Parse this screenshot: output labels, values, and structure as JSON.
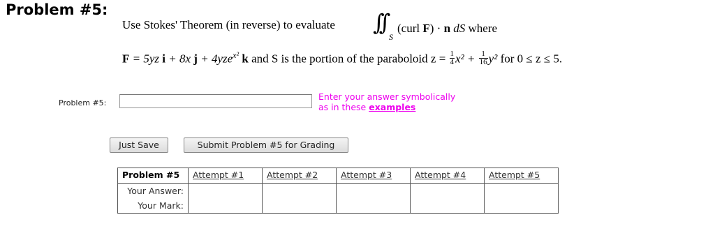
{
  "title": "Problem #5:",
  "statement": {
    "line1_pre": "Use Stokes' Theorem (in reverse) to evaluate",
    "integral_sign": "∫∫",
    "integral_sub": "S",
    "line1_post_a": "(curl ",
    "line1_post_F": "F",
    "line1_post_b": ") · ",
    "line1_post_n": "n",
    "line1_post_c": " dS",
    "line1_post_d": " where",
    "F_label": "F",
    "F_eq": " = 5yz ",
    "i": "i",
    "plus1": " + 8x ",
    "j": "j",
    "plus2": " + 4yze",
    "exp": "x²",
    "k": "k",
    "mid": " and S is the portion of the paraboloid z = ",
    "frac1_num": "1",
    "frac1_den": "4",
    "x2": "x² + ",
    "frac2_num": "1",
    "frac2_den": "16",
    "y2": "y²",
    "tail": "  for 0 ≤ z ≤ 5."
  },
  "answer": {
    "label": "Problem #5:",
    "value": "",
    "placeholder": "",
    "hint_line1": "Enter your answer symbolically",
    "hint_line2_prefix": "as in these ",
    "hint_link": "examples"
  },
  "buttons": {
    "save": "Just Save",
    "submit": "Submit Problem #5 for Grading"
  },
  "attempts_table": {
    "header_first": "Problem #5",
    "headers": [
      "Attempt #1",
      "Attempt #2",
      "Attempt #3",
      "Attempt #4",
      "Attempt #5"
    ],
    "row1_label": "Your Answer:",
    "row2_label": "Your Mark:"
  },
  "colors": {
    "hint": "#ee00ee",
    "background": "#ffffff"
  }
}
